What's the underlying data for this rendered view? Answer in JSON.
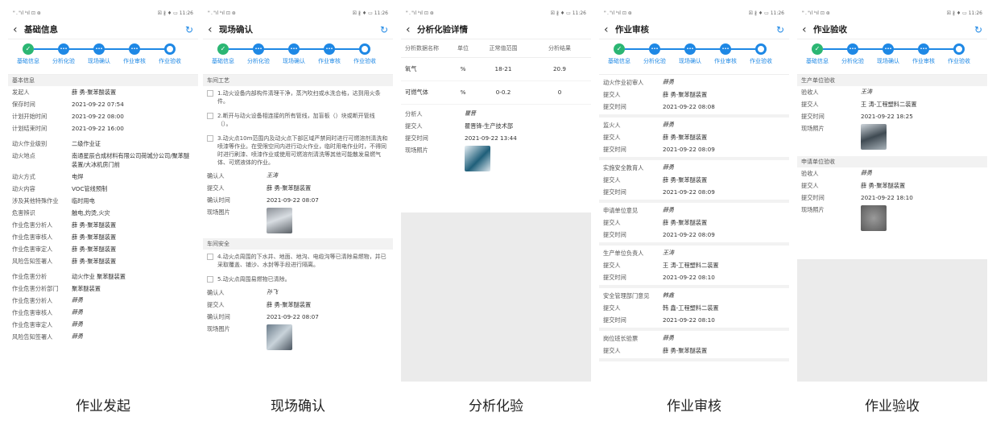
{
  "status": {
    "left": "\" . \"ıl ᵇıl ⊡ ⊛",
    "right": "☒ ∦ ♦ ▭ 11:26"
  },
  "steps": [
    "基础信息",
    "分析化验",
    "现场确认",
    "作业审核",
    "作业验收"
  ],
  "captions": [
    "作业发起",
    "现场确认",
    "分析化验",
    "作业审核",
    "作业验收"
  ],
  "p1": {
    "title": "基础信息",
    "section": "基本信息",
    "rows": [
      [
        "发起人",
        "薛 勇-聚苯酸装置"
      ],
      [
        "保存时间",
        "2021-09-22 07:54"
      ],
      [
        "计划开始时间",
        "2021-09-22 08:00"
      ],
      [
        "计划结束时间",
        "2021-09-22 16:00"
      ]
    ],
    "rows2": [
      [
        "动火作业级别",
        "二级作业证"
      ],
      [
        "动火地点",
        "南通星辰合成材料有限公司荷城分公司/聚苯醚装置/大冰机房门前"
      ],
      [
        "动火方式",
        "电焊"
      ],
      [
        "动火内容",
        "VOC管线预制"
      ],
      [
        "涉及其他特殊作业",
        "临时用电"
      ],
      [
        "危害辨识",
        "触电,灼烫,火灾"
      ],
      [
        "作业危害分析人",
        "薛 勇-聚苯醚装置"
      ],
      [
        "作业危害审核人",
        "薛 勇-聚苯醚装置"
      ],
      [
        "作业危害审定人",
        "薛 勇-聚苯醚装置"
      ],
      [
        "风险告知签署人",
        "薛 勇-聚苯醚装置"
      ]
    ],
    "rows3": [
      [
        "作业危害分析",
        "动火作业 聚苯醚装置"
      ],
      [
        "作业危害分析部门",
        "聚苯醚装置"
      ],
      [
        "作业危害分析人",
        "薛勇"
      ],
      [
        "作业危害审核人",
        "薛勇"
      ],
      [
        "作业危害审定人",
        "薛勇"
      ],
      [
        "风险告知签署人",
        "薛勇"
      ]
    ]
  },
  "p2": {
    "title": "现场确认",
    "sec1": "车间工艺",
    "checks1": [
      "1.动火设备内部构件清理干净，蒸汽吹扫或水洗合格，达到用火条件。",
      "2.断开与动火设备相连接的所有管线，加盲板（）块或断开管线（）。",
      "3.动火点10m范围内及动火点下部区域严禁同时进行可燃溶剂清洗和喷漆等作业。在受限空间内进行动火作业，临时用电作业时，不得同时进行刷漆、喷漆作业或使用可燃溶剂清洗等其他可能散发易燃气体、可燃液体的作业。"
    ],
    "rows1": [
      [
        "确认人",
        "王涛"
      ],
      [
        "提交人",
        "薛 勇-聚苯醚装置"
      ],
      [
        "确认时间",
        "2021-09-22 08:07"
      ],
      [
        "现场图片",
        ""
      ]
    ],
    "sec2": "车间安全",
    "checks2": [
      "4.动火点周围的下水井、地面、地沟、电缆沟等已清除易燃物，并已采取覆盖、铺沙、水封等手段进行隔离。",
      "5.动火点周围易燃物已清除。"
    ],
    "rows2": [
      [
        "确认人",
        "孙飞"
      ],
      [
        "提交人",
        "薛 勇-聚苯醚装置"
      ],
      [
        "确认时间",
        "2021-09-22 08:07"
      ],
      [
        "现场图片",
        ""
      ]
    ]
  },
  "p3": {
    "title": "分析化验详情",
    "head": [
      "分析数据名称",
      "单位",
      "正常值范围",
      "分析结果"
    ],
    "data": [
      [
        "氧气",
        "%",
        "18-21",
        "20.9"
      ],
      [
        "可燃气体",
        "%",
        "0-0.2",
        "0"
      ]
    ],
    "rows": [
      [
        "分析人",
        "瞿晋",
        "sig"
      ],
      [
        "提交人",
        "瞿晋锋-生产技术部",
        ""
      ],
      [
        "提交时间",
        "2021-09-22 13:44",
        ""
      ],
      [
        "现场照片",
        "",
        ""
      ]
    ]
  },
  "p4": {
    "title": "作业审核",
    "groups": [
      [
        [
          "动火作业初审人",
          "薛勇"
        ],
        [
          "提交人",
          "薛 勇-聚苯醚装置"
        ],
        [
          "提交时间",
          "2021-09-22 08:08"
        ]
      ],
      [
        [
          "监火人",
          "薛勇"
        ],
        [
          "提交人",
          "薛 勇-聚苯醚装置"
        ],
        [
          "提交时间",
          "2021-09-22 08:09"
        ]
      ],
      [
        [
          "实施安全教育人",
          "薛勇"
        ],
        [
          "提交人",
          "薛 勇-聚苯醚装置"
        ],
        [
          "提交时间",
          "2021-09-22 08:09"
        ]
      ],
      [
        [
          "申请单位意见",
          "薛勇"
        ],
        [
          "提交人",
          "薛 勇-聚苯醚装置"
        ],
        [
          "提交时间",
          "2021-09-22 08:09"
        ]
      ],
      [
        [
          "生产单位负责人",
          "王涛"
        ],
        [
          "提交人",
          "王 涛-工程塑料二装置"
        ],
        [
          "提交时间",
          "2021-09-22 08:10"
        ]
      ],
      [
        [
          "安全管理部门意见",
          "韩鑫"
        ],
        [
          "提交人",
          "韩 鑫-工程塑料二装置"
        ],
        [
          "提交时间",
          "2021-09-22 08:10"
        ]
      ],
      [
        [
          "岗位班长验票",
          "薛勇"
        ],
        [
          "提交人",
          "薛 勇-聚苯醚装置"
        ]
      ]
    ]
  },
  "p5": {
    "title": "作业验收",
    "sec1": "生产单位验收",
    "rows1": [
      [
        "验收人",
        "王涛"
      ],
      [
        "提交人",
        "王 涛-工程塑料二装置"
      ],
      [
        "提交时间",
        "2021-09-22 18:25"
      ],
      [
        "现场照片",
        ""
      ]
    ],
    "sec2": "申请单位验收",
    "rows2": [
      [
        "验收人",
        "薛勇"
      ],
      [
        "提交人",
        "薛 勇-聚苯醚装置"
      ],
      [
        "提交时间",
        "2021-09-22 18:10"
      ],
      [
        "现场照片",
        ""
      ]
    ]
  }
}
